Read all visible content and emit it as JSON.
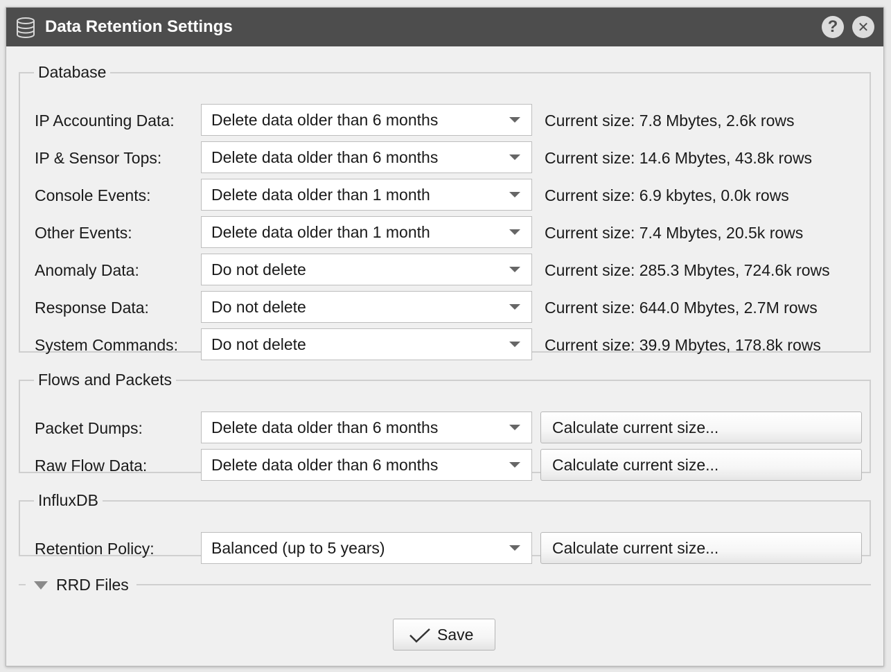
{
  "window": {
    "title": "Data Retention Settings",
    "icon": "database-icon",
    "help_glyph": "?",
    "close_glyph": "✕"
  },
  "database": {
    "legend": "Database",
    "rows": [
      {
        "label": "IP Accounting Data:",
        "value": "Delete data older than 6 months",
        "size": "Current size: 7.8 Mbytes, 2.6k rows"
      },
      {
        "label": "IP & Sensor Tops:",
        "value": "Delete data older than 6 months",
        "size": "Current size: 14.6 Mbytes, 43.8k rows"
      },
      {
        "label": "Console Events:",
        "value": "Delete data older than 1 month",
        "size": "Current size: 6.9 kbytes, 0.0k rows"
      },
      {
        "label": "Other Events:",
        "value": "Delete data older than 1 month",
        "size": "Current size: 7.4 Mbytes, 20.5k rows"
      },
      {
        "label": "Anomaly Data:",
        "value": "Do not delete",
        "size": "Current size: 285.3 Mbytes, 724.6k rows"
      },
      {
        "label": "Response Data:",
        "value": "Do not delete",
        "size": "Current size: 644.0 Mbytes, 2.7M rows"
      },
      {
        "label": "System Commands:",
        "value": "Do not delete",
        "size": "Current size: 39.9 Mbytes, 178.8k rows"
      }
    ]
  },
  "flows": {
    "legend": "Flows and Packets",
    "rows": [
      {
        "label": "Packet Dumps:",
        "value": "Delete data older than 6 months",
        "button": "Calculate current size..."
      },
      {
        "label": "Raw Flow Data:",
        "value": "Delete data older than 6 months",
        "button": "Calculate current size..."
      }
    ]
  },
  "influx": {
    "legend": "InfluxDB",
    "rows": [
      {
        "label": "Retention Policy:",
        "value": "Balanced (up to 5 years)",
        "button": "Calculate current size..."
      }
    ]
  },
  "rrd": {
    "label": "RRD Files",
    "toggle_icon": "triangle-down-icon"
  },
  "footer": {
    "save_label": "Save",
    "save_icon": "checkmark-icon"
  },
  "colors": {
    "titlebar": "#4d4d4d",
    "window_bg": "#f0f0f0"
  }
}
